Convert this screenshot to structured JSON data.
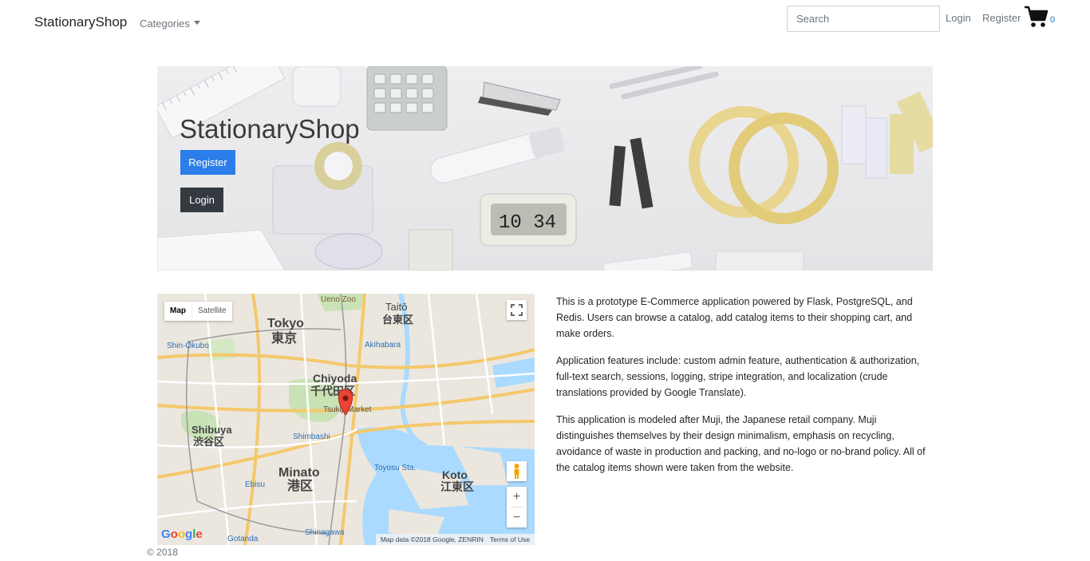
{
  "navbar": {
    "brand": "StationaryShop",
    "categories_label": "Categories",
    "search_placeholder": "Search",
    "login_label": "Login",
    "register_label": "Register",
    "cart_count": "0"
  },
  "hero": {
    "title": "StationaryShop",
    "register_button": "Register",
    "login_button": "Login",
    "clock_display": "10 34"
  },
  "map": {
    "type_map": "Map",
    "type_satellite": "Satellite",
    "logo": "Google",
    "attribution": "Map data ©2018 Google, ZENRIN",
    "terms": "Terms of Use",
    "zoom_in": "+",
    "zoom_out": "−",
    "labels": {
      "tokyo_en": "Tokyo",
      "tokyo_jp": "東京",
      "taito_en": "Taitō",
      "taito_jp": "台東区",
      "chiyoda_en": "Chiyoda",
      "chiyoda_jp": "千代田区",
      "shibuya_en": "Shibuya",
      "shibuya_jp": "渋谷区",
      "minato_en": "Minato",
      "minato_jp": "港区",
      "koto_en": "Koto",
      "koto_jp": "江東区",
      "shinjuku": "Shin-Ōkubo",
      "akihabara": "Akihabara",
      "ueno": "Ueno Zoo",
      "tsukiji": "Tsukiji Market",
      "shimbashi": "Shimbashi",
      "ebisu": "Ebisu",
      "toyosu": "Toyosu Sta.",
      "shinagawa": "Shinagawa",
      "gotanda": "Gotanda"
    }
  },
  "description": {
    "p1": "This is a prototype E-Commerce application powered by Flask, PostgreSQL, and Redis. Users can browse a catalog, add catalog items to their shopping cart, and make orders.",
    "p2": "Application features include: custom admin feature, authentication & authorization, full-text search, sessions, logging, stripe integration, and localization (crude translations provided by Google Translate).",
    "p3": "This application is modeled after Muji, the Japanese retail company. Muji distinguishes themselves by their design minimalism, emphasis on recycling, avoidance of waste in production and packing, and no-logo or no-brand policy. All of the catalog items shown were taken from the website."
  },
  "footer": {
    "copyright": "© 2018"
  },
  "colors": {
    "primary": "#2b7de9",
    "dark": "#343a40",
    "link": "#1a73c9"
  }
}
